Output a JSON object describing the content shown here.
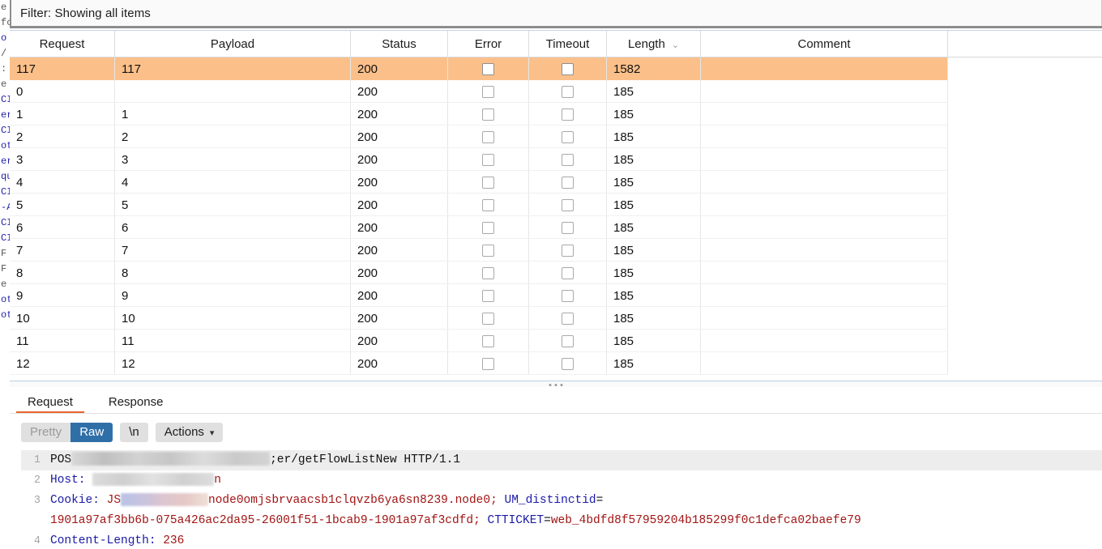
{
  "filter": {
    "label": "Filter: Showing all items"
  },
  "results_table": {
    "columns": [
      {
        "key": "request",
        "label": "Request"
      },
      {
        "key": "payload",
        "label": "Payload"
      },
      {
        "key": "status",
        "label": "Status"
      },
      {
        "key": "error",
        "label": "Error"
      },
      {
        "key": "timeout",
        "label": "Timeout"
      },
      {
        "key": "length",
        "label": "Length",
        "sort_icon": "chevron-down-icon"
      },
      {
        "key": "comment",
        "label": "Comment"
      }
    ],
    "rows": [
      {
        "request": "117",
        "payload": "117",
        "status": "200",
        "error": false,
        "timeout": false,
        "length": "1582",
        "comment": "",
        "selected": true
      },
      {
        "request": "0",
        "payload": "",
        "status": "200",
        "error": false,
        "timeout": false,
        "length": "185",
        "comment": "",
        "selected": false
      },
      {
        "request": "1",
        "payload": "1",
        "status": "200",
        "error": false,
        "timeout": false,
        "length": "185",
        "comment": "",
        "selected": false
      },
      {
        "request": "2",
        "payload": "2",
        "status": "200",
        "error": false,
        "timeout": false,
        "length": "185",
        "comment": "",
        "selected": false
      },
      {
        "request": "3",
        "payload": "3",
        "status": "200",
        "error": false,
        "timeout": false,
        "length": "185",
        "comment": "",
        "selected": false
      },
      {
        "request": "4",
        "payload": "4",
        "status": "200",
        "error": false,
        "timeout": false,
        "length": "185",
        "comment": "",
        "selected": false
      },
      {
        "request": "5",
        "payload": "5",
        "status": "200",
        "error": false,
        "timeout": false,
        "length": "185",
        "comment": "",
        "selected": false
      },
      {
        "request": "6",
        "payload": "6",
        "status": "200",
        "error": false,
        "timeout": false,
        "length": "185",
        "comment": "",
        "selected": false
      },
      {
        "request": "7",
        "payload": "7",
        "status": "200",
        "error": false,
        "timeout": false,
        "length": "185",
        "comment": "",
        "selected": false
      },
      {
        "request": "8",
        "payload": "8",
        "status": "200",
        "error": false,
        "timeout": false,
        "length": "185",
        "comment": "",
        "selected": false
      },
      {
        "request": "9",
        "payload": "9",
        "status": "200",
        "error": false,
        "timeout": false,
        "length": "185",
        "comment": "",
        "selected": false
      },
      {
        "request": "10",
        "payload": "10",
        "status": "200",
        "error": false,
        "timeout": false,
        "length": "185",
        "comment": "",
        "selected": false
      },
      {
        "request": "11",
        "payload": "11",
        "status": "200",
        "error": false,
        "timeout": false,
        "length": "185",
        "comment": "",
        "selected": false
      },
      {
        "request": "12",
        "payload": "12",
        "status": "200",
        "error": false,
        "timeout": false,
        "length": "185",
        "comment": "",
        "selected": false
      }
    ]
  },
  "message_tabs": [
    {
      "label": "Request",
      "active": true
    },
    {
      "label": "Response",
      "active": false
    }
  ],
  "editor_toolbar": {
    "pretty_label": "Pretty",
    "raw_label": "Raw",
    "newline_label": "\\n",
    "actions_label": "Actions",
    "actions_icon": "chevron-down-icon",
    "selected_view": "Raw"
  },
  "request_editor": {
    "lines": [
      {
        "number": "1",
        "parts": [
          {
            "t": "plain",
            "v": "POS"
          },
          {
            "t": "redact",
            "size": "b1"
          },
          {
            "t": "plain",
            "v": ";er/getFlowListNew HTTP/1.1"
          }
        ]
      },
      {
        "number": "2",
        "parts": [
          {
            "t": "key",
            "v": "Host:"
          },
          {
            "t": "plain",
            "v": " "
          },
          {
            "t": "redact",
            "size": "b2"
          },
          {
            "t": "value",
            "v": "n"
          }
        ]
      },
      {
        "number": "3",
        "parts": [
          {
            "t": "key",
            "v": "Cookie:"
          },
          {
            "t": "plain",
            "v": " "
          },
          {
            "t": "value",
            "v": "JS"
          },
          {
            "t": "redact",
            "size": "b3"
          },
          {
            "t": "value",
            "v": "node0omjsbrvaacsb1clqvzb6ya6sn8239.node0;"
          },
          {
            "t": "plain",
            "v": " "
          },
          {
            "t": "key",
            "v": "UM_distinctid"
          },
          {
            "t": "plain",
            "v": "="
          }
        ]
      },
      {
        "number": "",
        "parts": [
          {
            "t": "value",
            "v": "1901a97af3bb6b-075a426ac2da95-26001f51-1bcab9-1901a97af3cdfd;"
          },
          {
            "t": "plain",
            "v": " "
          },
          {
            "t": "key",
            "v": "CTTICKET"
          },
          {
            "t": "plain",
            "v": "="
          },
          {
            "t": "value",
            "v": "web_4bdfd8f57959204b185299f0c1defca02baefe79"
          }
        ]
      },
      {
        "number": "4",
        "parts": [
          {
            "t": "key",
            "v": "Content-Length:"
          },
          {
            "t": "plain",
            "v": " "
          },
          {
            "t": "value",
            "v": "236"
          }
        ]
      }
    ]
  },
  "background_window": {
    "fragments": [
      {
        "text": "",
        "color": "red"
      },
      {
        "text": "",
        "color": "gry"
      },
      {
        "text": "e",
        "color": "gry"
      },
      {
        "text": "fc",
        "color": "gry"
      },
      {
        "text": "",
        "color": "gry"
      },
      {
        "text": "o",
        "color": "blue"
      },
      {
        "text": "",
        "color": "gry"
      },
      {
        "text": "",
        "color": "gry"
      },
      {
        "text": "/",
        "color": "gry"
      },
      {
        "text": ":",
        "color": "gry"
      },
      {
        "text": "e",
        "color": "gry"
      },
      {
        "text": "CI",
        "color": "blue"
      },
      {
        "text": "er",
        "color": "blue"
      },
      {
        "text": "CI",
        "color": "blue"
      },
      {
        "text": "ot",
        "color": "blue"
      },
      {
        "text": "er",
        "color": "blue"
      },
      {
        "text": "qu",
        "color": "blue"
      },
      {
        "text": "CI",
        "color": "blue"
      },
      {
        "text": "-A",
        "color": "blue"
      },
      {
        "text": "CI",
        "color": "blue"
      },
      {
        "text": "CI",
        "color": "blue"
      },
      {
        "text": "F e",
        "color": "gry"
      },
      {
        "text": "F e",
        "color": "gry"
      },
      {
        "text": "e",
        "color": "gry"
      },
      {
        "text": "ot",
        "color": "blue"
      },
      {
        "text": "ot",
        "color": "blue"
      }
    ]
  },
  "colors": {
    "selection": "#fbc08a",
    "accent": "#e8642c",
    "active_button": "#2f6fa8"
  }
}
